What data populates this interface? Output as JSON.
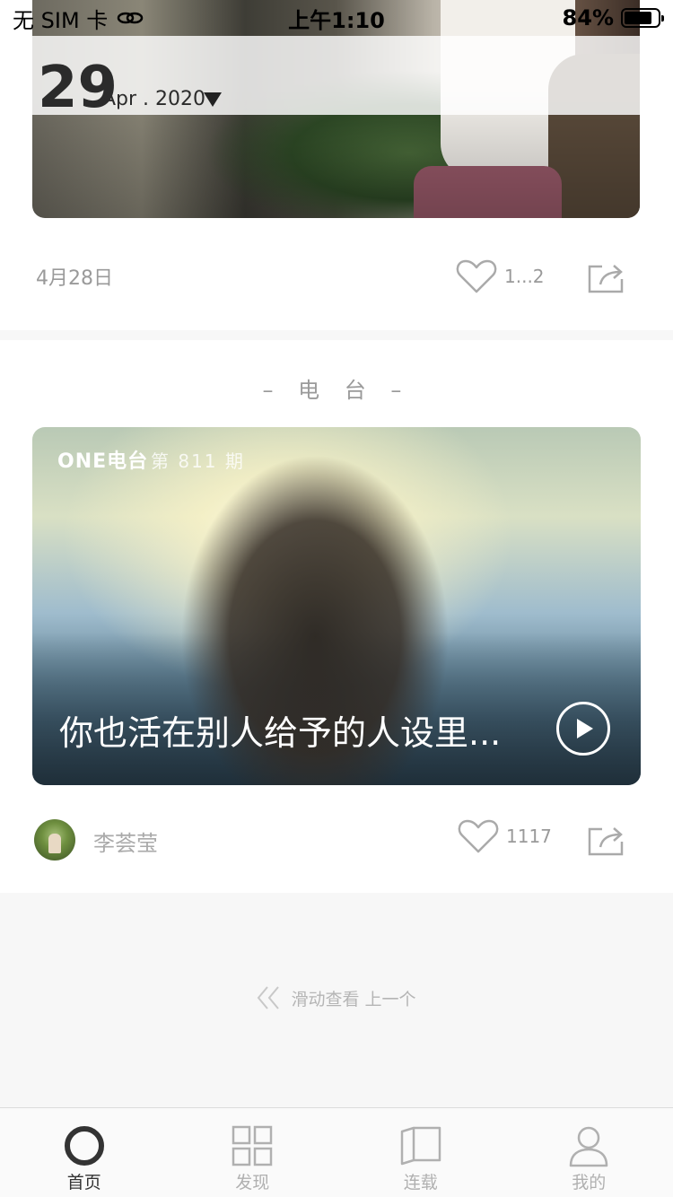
{
  "status_bar": {
    "carrier": "无 SIM 卡",
    "time": "上午1:10",
    "battery_percent": "84%",
    "battery_level": 0.84
  },
  "top_card": {
    "day": "29",
    "month_year": "Apr . 2020",
    "date_label": "4月28日",
    "like_count": "1...2"
  },
  "radio_card": {
    "section_title": "– 电 台 –",
    "logo": "ONE电台",
    "issue": "第 811 期",
    "title": "你也活在别人给予的人设里...",
    "author": "李荟莹",
    "like_count": "1117"
  },
  "prev_hint": "滑动查看 上一个",
  "tab_bar": {
    "tabs": [
      {
        "label": "首页",
        "icon": "circle-icon",
        "active": true
      },
      {
        "label": "发现",
        "icon": "grid-icon",
        "active": false
      },
      {
        "label": "连载",
        "icon": "book-icon",
        "active": false
      },
      {
        "label": "我的",
        "icon": "person-icon",
        "active": false
      }
    ]
  },
  "colors": {
    "accent_dark": "#333333",
    "muted_text": "#9a9a9a",
    "background": "#f7f7f7"
  }
}
